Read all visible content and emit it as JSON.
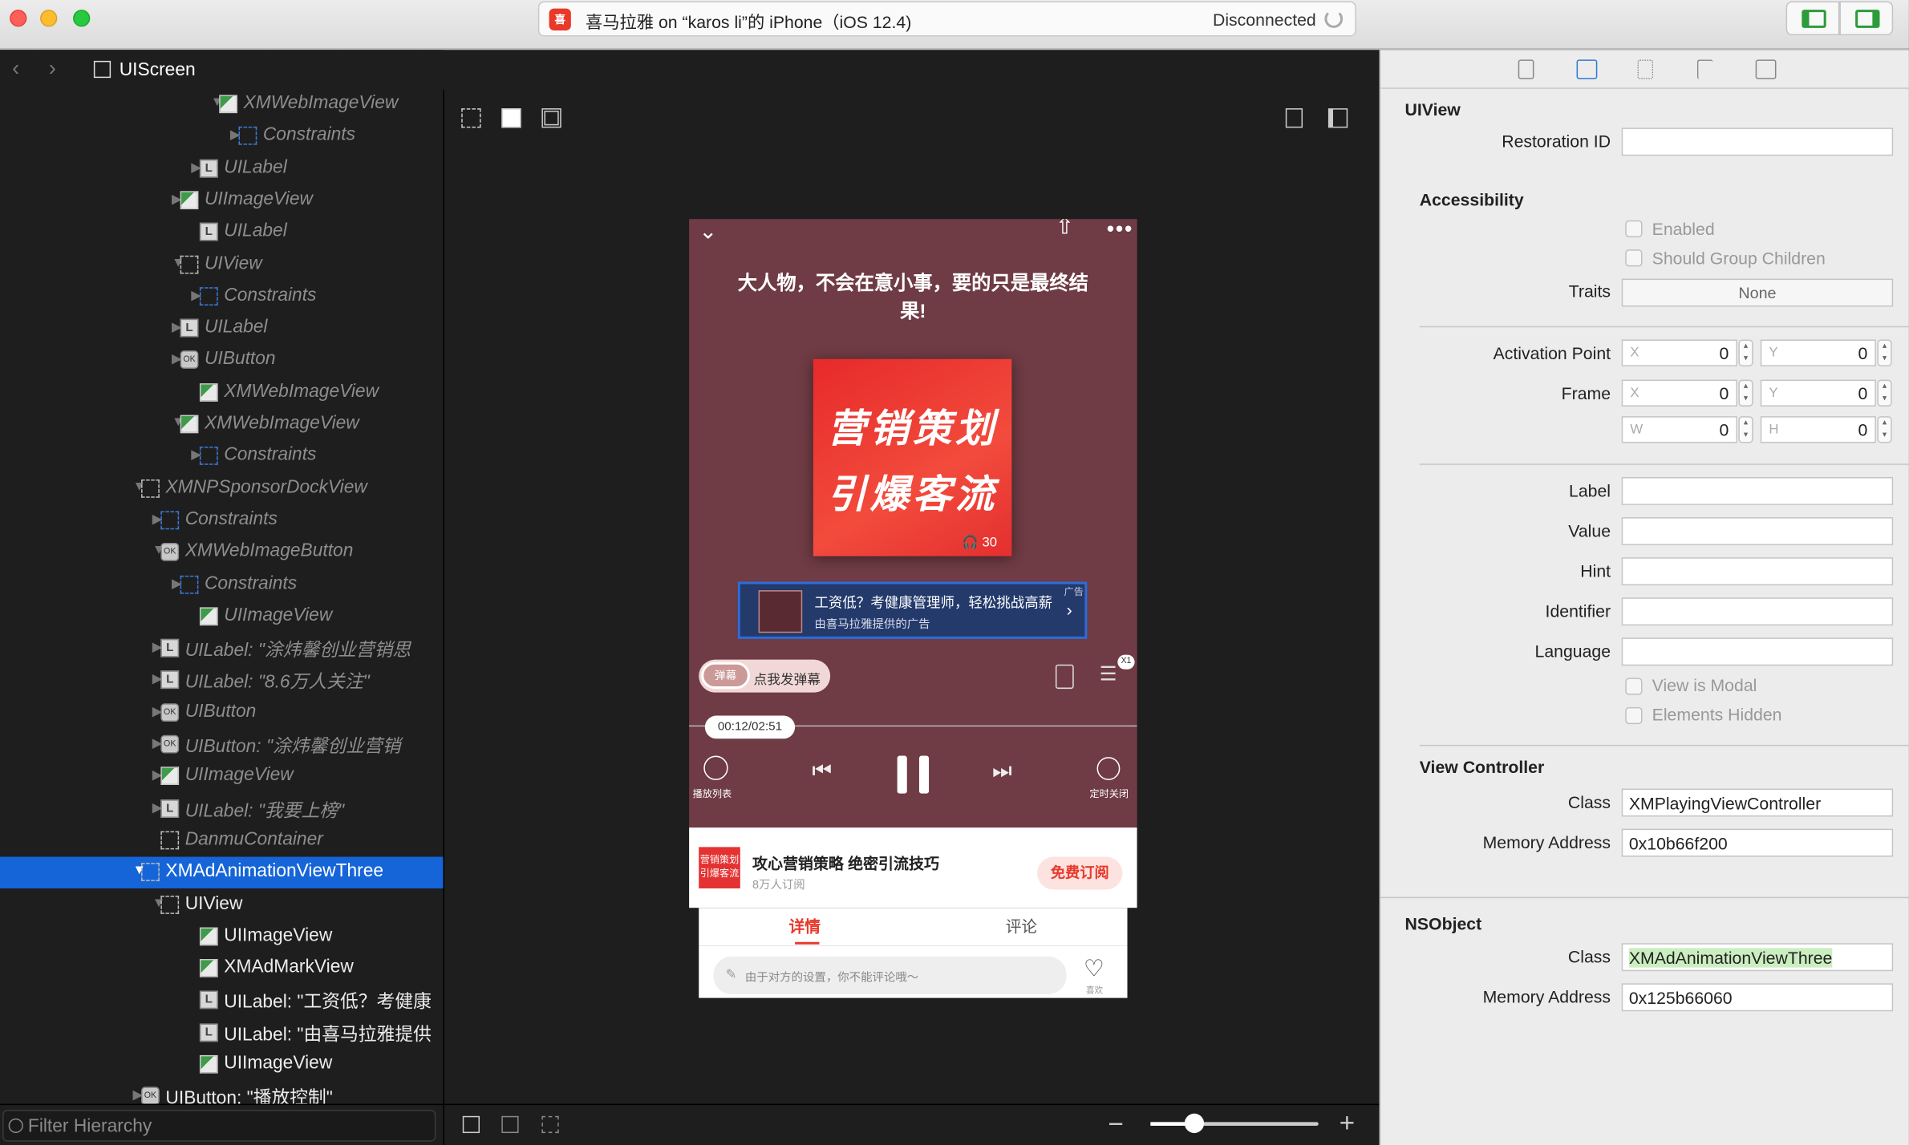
{
  "window": {
    "title": "喜马拉雅 on “karos li”的 iPhone（iOS 12.4)",
    "status": "Disconnected",
    "app_icon_text": "喜"
  },
  "nav": {
    "root_label": "UIScreen",
    "back": "‹",
    "forward": "›"
  },
  "tree": [
    {
      "label": "XMWebImageView",
      "icon": "img",
      "expanded": true
    },
    {
      "label": "Constraints",
      "icon": "cons",
      "expanded": false
    },
    {
      "label": "UILabel",
      "icon": "lbl",
      "expanded": false
    },
    {
      "label": "UIImageView",
      "icon": "img",
      "expanded": false
    },
    {
      "label": "UILabel",
      "icon": "lbl",
      "expanded": null
    },
    {
      "label": "UIView",
      "icon": "view",
      "expanded": true
    },
    {
      "label": "Constraints",
      "icon": "cons",
      "expanded": false
    },
    {
      "label": "UILabel",
      "icon": "lbl",
      "expanded": false
    },
    {
      "label": "UIButton",
      "icon": "btn",
      "expanded": false
    },
    {
      "label": "XMWebImageView",
      "icon": "img",
      "expanded": null
    },
    {
      "label": "XMWebImageView",
      "icon": "img",
      "expanded": true
    },
    {
      "label": "Constraints",
      "icon": "cons",
      "expanded": false
    },
    {
      "label": "XMNPSponsorDockView",
      "icon": "view",
      "expanded": true
    },
    {
      "label": "Constraints",
      "icon": "cons",
      "expanded": false
    },
    {
      "label": "XMWebImageButton",
      "icon": "btn",
      "expanded": true
    },
    {
      "label": "Constraints",
      "icon": "cons",
      "expanded": false
    },
    {
      "label": "UIImageView",
      "icon": "img",
      "expanded": null
    },
    {
      "label": "UILabel: \"涂炜馨创业营销思",
      "icon": "lbl",
      "expanded": false
    },
    {
      "label": "UILabel: \"8.6万人关注\"",
      "icon": "lbl",
      "expanded": false
    },
    {
      "label": "UIButton",
      "icon": "btn",
      "expanded": false
    },
    {
      "label": "UIButton: \"涂炜馨创业营销",
      "icon": "btn",
      "expanded": false
    },
    {
      "label": "UIImageView",
      "icon": "img",
      "expanded": false
    },
    {
      "label": "UILabel: \"我要上榜\"",
      "icon": "lbl",
      "expanded": false
    },
    {
      "label": "DanmuContainer",
      "icon": "view",
      "expanded": null
    },
    {
      "label": "XMAdAnimationViewThree",
      "icon": "view",
      "expanded": true,
      "selected": true
    },
    {
      "label": "UIView",
      "icon": "view",
      "expanded": true
    },
    {
      "label": "UIImageView",
      "icon": "img",
      "expanded": null
    },
    {
      "label": "XMAdMarkView",
      "icon": "img",
      "expanded": null
    },
    {
      "label": "UILabel: \"工资低？考健康",
      "icon": "lbl",
      "expanded": null
    },
    {
      "label": "UILabel: \"由喜马拉雅提供",
      "icon": "lbl",
      "expanded": null
    },
    {
      "label": "UIImageView",
      "icon": "img",
      "expanded": null
    },
    {
      "label": "UIButton: \"播放控制\"",
      "icon": "btn",
      "expanded": false
    }
  ],
  "filter": {
    "placeholder": "Filter Hierarchy"
  },
  "phone": {
    "title": "大人物，不会在意小事，要的只是最终结果!",
    "cover_line1": "营销策划",
    "cover_line2": "引爆客流",
    "play_count": "🎧 30",
    "ad_line1": "工资低？考健康管理师，轻松挑战高薪",
    "ad_line2": "由喜马拉雅提供的广告",
    "ad_tag": "广告",
    "danmu_icon": "弹幕",
    "danmu_text": "点我发弹幕",
    "speed": "X1",
    "time": "00:12/02:51",
    "playlist_label": "播放列表",
    "timer_label": "定时关闭",
    "album_thumb": "营销策划 引爆客流",
    "album_title": "攻心营销策略 绝密引流技巧",
    "album_sub": "8万人订阅",
    "subscribe": "免费订阅",
    "tab_detail": "详情",
    "tab_comment": "评论",
    "comment_placeholder": "由于对方的设置，你不能评论哦～",
    "like_label": "喜欢"
  },
  "inspector": {
    "uiview_title": "UIView",
    "restoration_id_label": "Restoration ID",
    "restoration_id": "",
    "accessibility_title": "Accessibility",
    "enabled_label": "Enabled",
    "group_children_label": "Should Group Children",
    "traits_label": "Traits",
    "traits_value": "None",
    "activation_label": "Activation Point",
    "frame_label": "Frame",
    "x_ph": "X",
    "y_ph": "Y",
    "w_ph": "W",
    "h_ph": "H",
    "activation_x": "0",
    "activation_y": "0",
    "frame_x": "0",
    "frame_y": "0",
    "frame_w": "0",
    "frame_h": "0",
    "label_label": "Label",
    "value_label": "Value",
    "hint_label": "Hint",
    "identifier_label": "Identifier",
    "language_label": "Language",
    "view_modal_label": "View is Modal",
    "elements_hidden_label": "Elements Hidden",
    "vc_title": "View Controller",
    "class_label": "Class",
    "vc_class": "XMPlayingViewController",
    "memory_label": "Memory Address",
    "vc_memory": "0x10b66f200",
    "nsobject_title": "NSObject",
    "ns_class": "XMAdAnimationViewThree",
    "ns_memory": "0x125b66060"
  },
  "colors": {
    "selection": "#1565d8",
    "accent_green": "#2c9b3a",
    "phone_bg": "#6f3b44",
    "brand_red": "#e83a2c"
  }
}
